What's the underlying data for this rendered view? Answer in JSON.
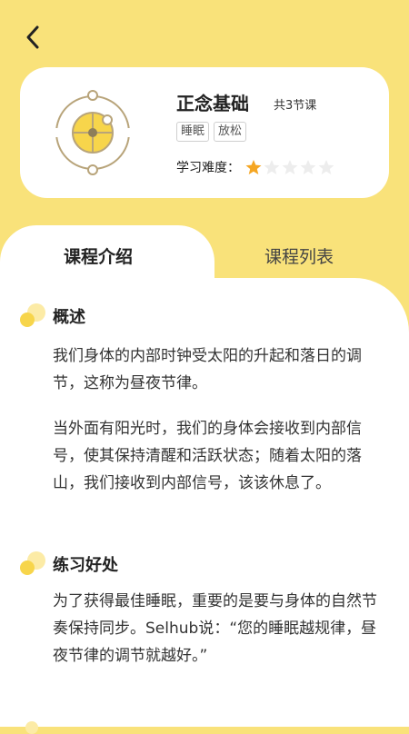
{
  "course": {
    "title": "正念基础",
    "lesson_count": "共3节课",
    "tags": [
      "睡眠",
      "放松"
    ],
    "difficulty_label": "学习难度：",
    "difficulty_rating": 1,
    "difficulty_max": 5
  },
  "tabs": {
    "intro": "课程介绍",
    "list": "课程列表"
  },
  "sections": {
    "overview": {
      "title": "概述",
      "paragraphs": [
        "我们身体的内部时钟受太阳的升起和落日的调节，这称为昼夜节律。",
        "当外面有阳光时，我们的身体会接收到内部信号，使其保持清醒和活跃状态；随着太阳的落山，我们接收到内部信号，该该休息了。"
      ]
    },
    "benefits": {
      "title": "练习好处",
      "paragraphs": [
        "为了获得最佳睡眠，重要的是要与身体的自然节奏保持同步。Selhub说：“您的睡眠越规律，昼夜节律的调节就越好。”"
      ]
    }
  },
  "colors": {
    "background": "#F9E27A",
    "star_filled": "#F5A623",
    "star_empty": "#EDEDED",
    "icon_stroke": "#B8A47A",
    "icon_fill": "#F7D54B"
  }
}
